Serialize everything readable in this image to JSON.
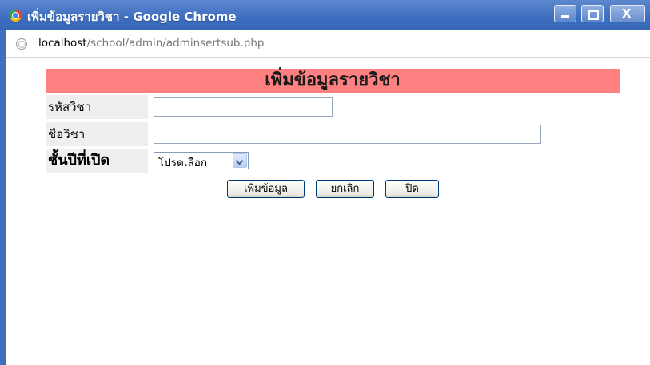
{
  "window": {
    "title": "เพิ่มข้อมูลรายวิชา - Google Chrome",
    "controls": {
      "minimize": "–",
      "maximize": "□",
      "close": "X"
    }
  },
  "address_bar": {
    "host": "localhost",
    "path": "/school/admin/adminsertsub.php"
  },
  "form": {
    "heading": "เพิ่มข้อมูลรายวิชา",
    "fields": {
      "code_label": "รหัสวิชา",
      "code_value": "",
      "name_label": "ชื่อวิชา",
      "name_value": "",
      "level_label": "ชั้นปีที่เปิด",
      "level_selected": "โปรดเลือก"
    },
    "buttons": {
      "add": "เพิ่มข้อมูล",
      "cancel": "ยกเลิก",
      "close": "ปิด"
    }
  },
  "colors": {
    "titlebar": "#3f6fbf",
    "heading_bg": "#ff8080",
    "label_bg": "#efefef"
  }
}
